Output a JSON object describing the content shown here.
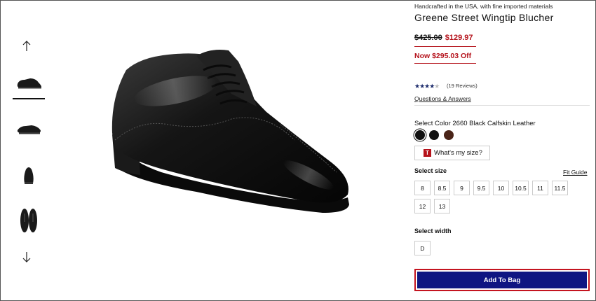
{
  "gallery": {
    "thumbnails": [
      {
        "label": "side view",
        "active": true
      },
      {
        "label": "angled view",
        "active": false
      },
      {
        "label": "front view",
        "active": false
      },
      {
        "label": "top pair view",
        "active": false
      }
    ],
    "up_arrow": "↑",
    "down_arrow": "↓"
  },
  "product": {
    "origin": "Handcrafted in the USA, with fine imported materials",
    "title": "Greene Street Wingtip Blucher",
    "price_old": "$425.00",
    "price_new": "$129.97",
    "discount": "Now $295.03 Off",
    "rating_stars": "★★★★",
    "rating_dim": "★",
    "reviews": "(19 Reviews)",
    "qa_link": "Questions & Answers"
  },
  "color": {
    "label": "Select Color",
    "value": "2660 Black Calfskin Leather",
    "swatches": [
      {
        "color": "#111111",
        "selected": true
      },
      {
        "color": "#1a1a1a",
        "selected": false
      },
      {
        "color": "#4a2418",
        "selected": false
      }
    ]
  },
  "size_help": {
    "badge": "T",
    "label": "What's my size?"
  },
  "size": {
    "label": "Select size",
    "fit_guide": "Fit Guide",
    "options": [
      "8",
      "8.5",
      "9",
      "9.5",
      "10",
      "10.5",
      "11",
      "11.5",
      "12",
      "13"
    ]
  },
  "width": {
    "label": "Select width",
    "options": [
      "D"
    ]
  },
  "cta": {
    "add_to_bag": "Add To Bag"
  },
  "colors": {
    "accent_red": "#b5121b",
    "button_navy": "#0f1582"
  }
}
